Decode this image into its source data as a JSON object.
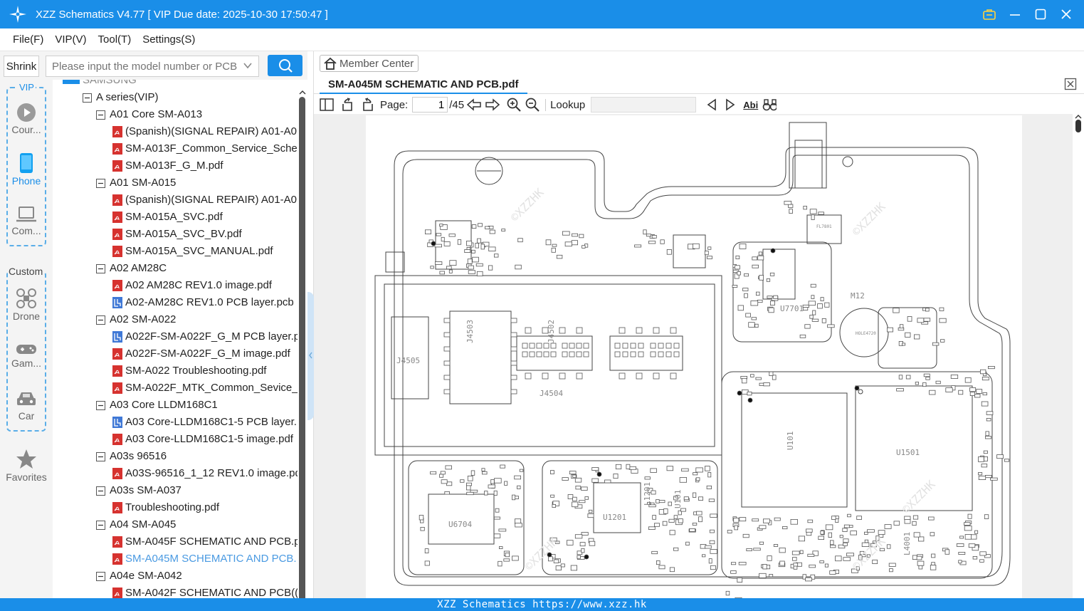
{
  "window": {
    "title": "XZZ Schematics V4.77 [ VIP Due date: 2025-10-30 17:50:47 ]"
  },
  "menu": [
    "File(F)",
    "VIP(V)",
    "Tool(T)",
    "Settings(S)"
  ],
  "toolbar": {
    "shrink_label": "Shrink",
    "search_placeholder": "Please input the model number or PCB"
  },
  "sidebar": {
    "vip_legend": "VIP",
    "vip_items": [
      "Cour...",
      "Phone",
      "Com..."
    ],
    "custom_legend": "Custom",
    "custom_items": [
      "Drone",
      "Gam...",
      "Car"
    ],
    "favorites": "Favorites"
  },
  "tree": {
    "root_partial": "SAMSUNG",
    "nodes": [
      {
        "level": 1,
        "kind": "folder",
        "label": "A series(VIP)"
      },
      {
        "level": 2,
        "kind": "folder",
        "label": "A01 Core SM-A013"
      },
      {
        "level": 3,
        "kind": "pdf",
        "label": "(Spanish)(SIGNAL REPAIR) A01-A0"
      },
      {
        "level": 3,
        "kind": "pdf",
        "label": "SM-A013F_Common_Service_Scher"
      },
      {
        "level": 3,
        "kind": "pdf",
        "label": "SM-A013F_G_M.pdf"
      },
      {
        "level": 2,
        "kind": "folder",
        "label": "A01 SM-A015"
      },
      {
        "level": 3,
        "kind": "pdf",
        "label": "(Spanish)(SIGNAL REPAIR) A01-A0"
      },
      {
        "level": 3,
        "kind": "pdf",
        "label": "SM-A015A_SVC.pdf"
      },
      {
        "level": 3,
        "kind": "pdf",
        "label": "SM-A015A_SVC_BV.pdf"
      },
      {
        "level": 3,
        "kind": "pdf",
        "label": "SM-A015A_SVC_MANUAL.pdf"
      },
      {
        "level": 2,
        "kind": "folder",
        "label": "A02 AM28C"
      },
      {
        "level": 3,
        "kind": "pdf",
        "label": "A02 AM28C REV1.0 image.pdf"
      },
      {
        "level": 3,
        "kind": "pcb",
        "label": "A02-AM28C REV1.0 PCB layer.pcb"
      },
      {
        "level": 2,
        "kind": "folder",
        "label": "A02 SM-A022"
      },
      {
        "level": 3,
        "kind": "pcb",
        "label": "A022F-SM-A022F_G_M PCB layer.p"
      },
      {
        "level": 3,
        "kind": "pdf",
        "label": "A022F-SM-A022F_G_M image.pdf"
      },
      {
        "level": 3,
        "kind": "pdf",
        "label": "SM-A022 Troubleshooting.pdf"
      },
      {
        "level": 3,
        "kind": "pdf",
        "label": "SM-A022F_MTK_Common_Sevice_S"
      },
      {
        "level": 2,
        "kind": "folder",
        "label": "A03 Core LLDM168C1"
      },
      {
        "level": 3,
        "kind": "pcb",
        "label": "A03 Core-LLDM168C1-5 PCB layer."
      },
      {
        "level": 3,
        "kind": "pdf",
        "label": "A03 Core-LLDM168C1-5 image.pdf"
      },
      {
        "level": 2,
        "kind": "folder",
        "label": "A03s 96516"
      },
      {
        "level": 3,
        "kind": "pdf",
        "label": "A03S-96516_1_12 REV1.0 image.pd"
      },
      {
        "level": 2,
        "kind": "folder",
        "label": "A03s SM-A037"
      },
      {
        "level": 3,
        "kind": "pdf",
        "label": "Troubleshooting.pdf"
      },
      {
        "level": 2,
        "kind": "folder",
        "label": "A04 SM-A045"
      },
      {
        "level": 3,
        "kind": "pdf",
        "label": "SM-A045F SCHEMATIC AND PCB.p"
      },
      {
        "level": 3,
        "kind": "pdf",
        "label": "SM-A045M SCHEMATIC AND PCB.",
        "selected": true
      },
      {
        "level": 2,
        "kind": "folder",
        "label": "A04e SM-A042"
      },
      {
        "level": 3,
        "kind": "pdf",
        "label": "SM-A042F SCHEMATIC AND PCB(("
      }
    ]
  },
  "viewer": {
    "member_center": "Member Center",
    "tab_title": "SM-A045M SCHEMATIC AND PCB.pdf",
    "page_label": "Page:",
    "page_current": "1",
    "page_total": "/45",
    "lookup_label": "Lookup",
    "lookup_value": "",
    "abi_label": "Abi"
  },
  "pcb": {
    "labels": [
      "J4505",
      "J4503",
      "J4502",
      "J4504",
      "U7701",
      "M12",
      "U1501",
      "U101",
      "U6704",
      "U1201",
      "L1201",
      "L4001",
      "FL7801",
      "U101",
      "HOLE4720"
    ],
    "watermark": "©XZZHK"
  },
  "footer": {
    "text": "XZZ Schematics https://www.xzz.hk"
  },
  "colors": {
    "accent": "#1a8ee8",
    "pdf_icon": "#d6322f",
    "pcb_icon": "#3f78d6",
    "selected_text": "#4a9ae2"
  }
}
